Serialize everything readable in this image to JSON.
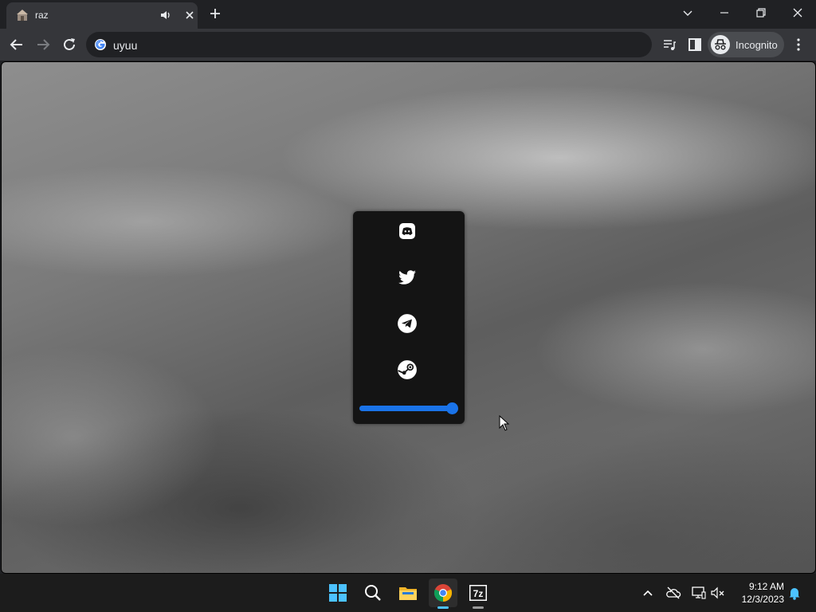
{
  "browser": {
    "tab": {
      "title": "raz"
    },
    "omnibox": {
      "url": "uyuu"
    },
    "profile": {
      "label": "Incognito"
    }
  },
  "page": {
    "socials": [
      {
        "name": "discord-icon"
      },
      {
        "name": "twitter-icon"
      },
      {
        "name": "telegram-icon"
      },
      {
        "name": "steam-icon"
      }
    ],
    "volume": {
      "value": 1.0
    },
    "accent_color": "#1a73e8"
  },
  "taskbar": {
    "apps": [
      "windows-start",
      "search",
      "file-explorer",
      "chrome",
      "7zip"
    ],
    "sevenzip_label": "7z",
    "clock": {
      "time": "9:12 AM",
      "date": "12/3/2023"
    }
  }
}
